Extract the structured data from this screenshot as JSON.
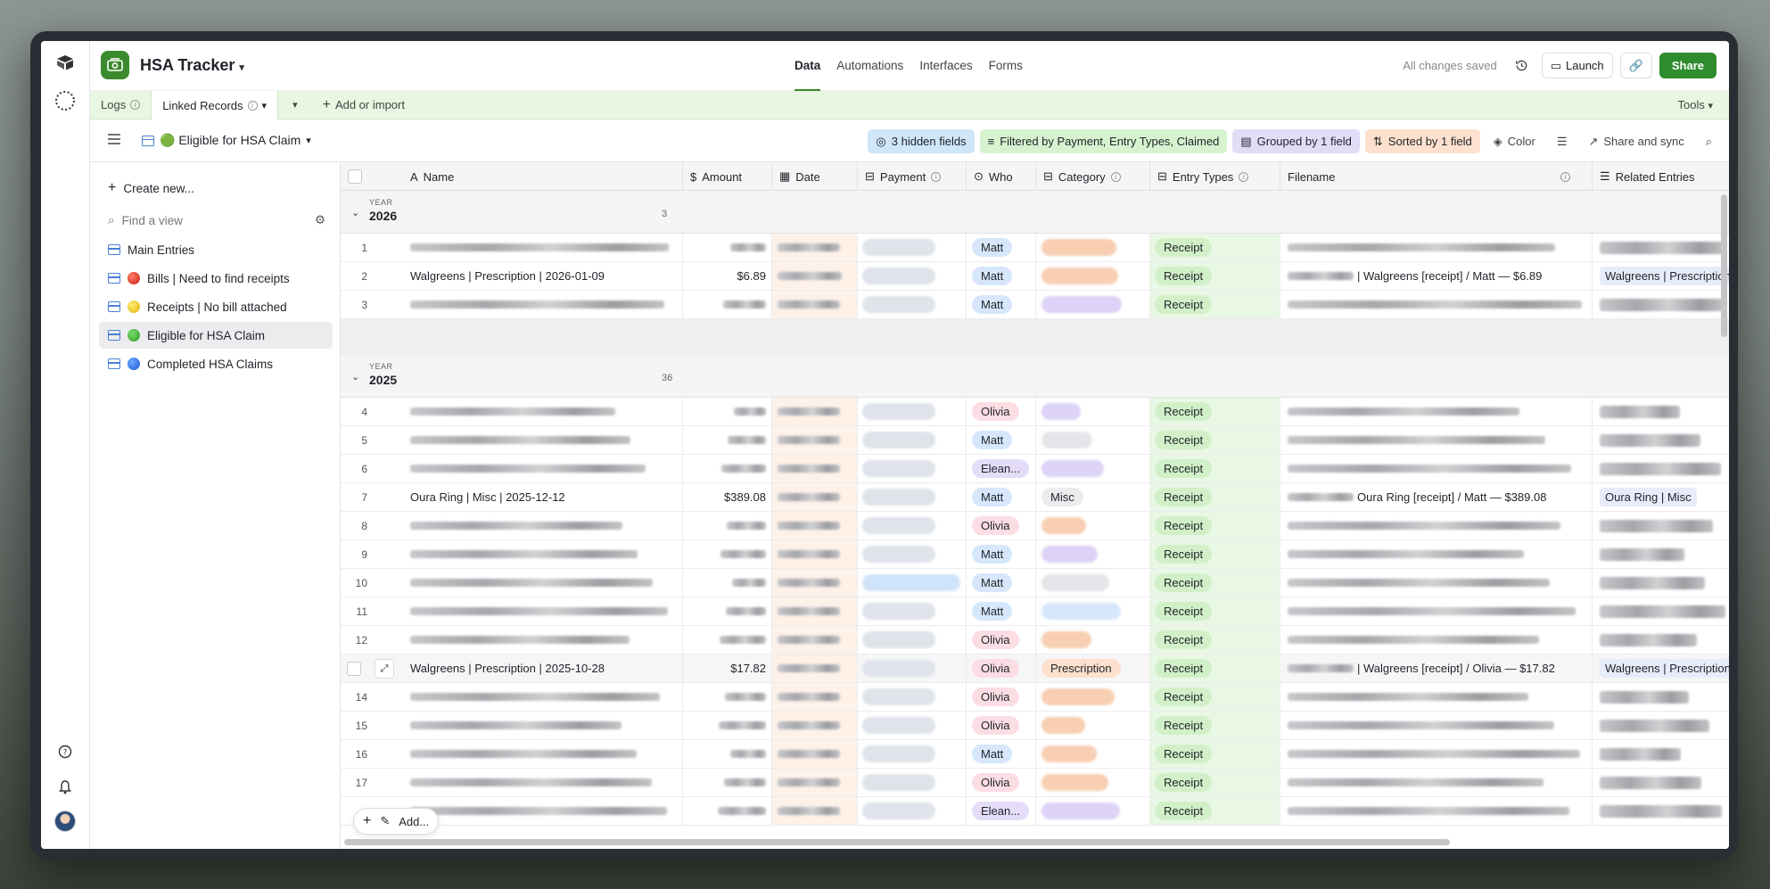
{
  "base": {
    "name": "HSA Tracker"
  },
  "topnav": {
    "data": "Data",
    "automations": "Automations",
    "interfaces": "Interfaces",
    "forms": "Forms"
  },
  "topright": {
    "saved": "All changes saved",
    "launch": "Launch",
    "share": "Share"
  },
  "tabs": {
    "logs": "Logs",
    "linked": "Linked Records",
    "add": "Add or import",
    "tools": "Tools"
  },
  "view": {
    "name": "🟢 Eligible for HSA Claim"
  },
  "viewbar": {
    "hidden": "3 hidden fields",
    "filter": "Filtered by Payment, Entry Types, Claimed",
    "group": "Grouped by 1 field",
    "sort": "Sorted by 1 field",
    "color": "Color",
    "share": "Share and sync"
  },
  "sidebar": {
    "create": "Create new...",
    "find": "Find a view",
    "items": [
      {
        "label": "Main Entries"
      },
      {
        "label": "Bills | Need to find receipts"
      },
      {
        "label": "Receipts | No bill attached"
      },
      {
        "label": "Eligible for HSA Claim"
      },
      {
        "label": "Completed HSA Claims"
      }
    ]
  },
  "columns": {
    "name": "Name",
    "amount": "Amount",
    "date": "Date",
    "payment": "Payment",
    "who": "Who",
    "category": "Category",
    "entry_types": "Entry Types",
    "filename": "Filename",
    "related": "Related Entries"
  },
  "groups": [
    {
      "label": "YEAR",
      "year": "2026",
      "count": "3"
    },
    {
      "label": "YEAR",
      "year": "2025",
      "count": "36"
    }
  ],
  "rows": {
    "r1": {
      "num": "1",
      "who": "Matt",
      "entry": "Receipt"
    },
    "r2": {
      "num": "2",
      "name": "Walgreens | Prescription | 2026-01-09",
      "amount": "$6.89",
      "who": "Matt",
      "entry": "Receipt",
      "filename": "| Walgreens [receipt] / Matt — $6.89",
      "related": "Walgreens | Prescription"
    },
    "r3": {
      "num": "3",
      "who": "Matt",
      "entry": "Receipt"
    },
    "r4": {
      "num": "4",
      "who": "Olivia",
      "entry": "Receipt"
    },
    "r5": {
      "num": "5",
      "who": "Matt",
      "entry": "Receipt"
    },
    "r6": {
      "num": "6",
      "who": "Elean...",
      "entry": "Receipt"
    },
    "r7": {
      "num": "7",
      "name": "Oura Ring | Misc | 2025-12-12",
      "amount": "$389.08",
      "who": "Matt",
      "category": "Misc",
      "entry": "Receipt",
      "filename": "Oura Ring [receipt] / Matt — $389.08",
      "related": "Oura Ring | Misc"
    },
    "r8": {
      "num": "8",
      "who": "Olivia",
      "entry": "Receipt"
    },
    "r9": {
      "num": "9",
      "who": "Matt",
      "entry": "Receipt"
    },
    "r10": {
      "num": "10",
      "who": "Matt",
      "entry": "Receipt"
    },
    "r11": {
      "num": "11",
      "who": "Matt",
      "entry": "Receipt"
    },
    "r12": {
      "num": "12",
      "who": "Olivia",
      "entry": "Receipt"
    },
    "r13": {
      "name": "Walgreens | Prescription | 2025-10-28",
      "amount": "$17.82",
      "who": "Olivia",
      "category": "Prescription",
      "entry": "Receipt",
      "filename": "| Walgreens [receipt] / Olivia — $17.82",
      "related": "Walgreens | Prescription"
    },
    "r14": {
      "num": "14",
      "who": "Olivia",
      "entry": "Receipt"
    },
    "r15": {
      "num": "15",
      "who": "Olivia",
      "entry": "Receipt"
    },
    "r16": {
      "num": "16",
      "who": "Matt",
      "entry": "Receipt"
    },
    "r17": {
      "num": "17",
      "who": "Olivia",
      "entry": "Receipt"
    },
    "r18": {
      "who": "Elean...",
      "entry": "Receipt"
    }
  },
  "footer": {
    "add": "Add..."
  }
}
